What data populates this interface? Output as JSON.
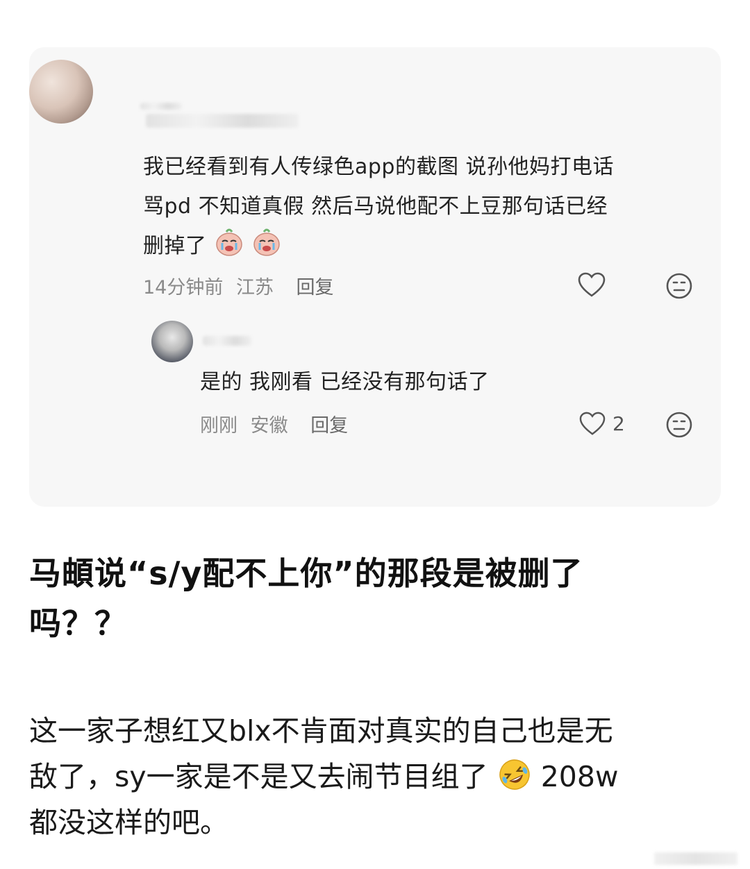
{
  "comment": {
    "text_line1": "我已经看到有人传绿色app的截图 说孙他妈打电话",
    "text_line2": "骂pd  不知道真假 然后马说他配不上豆那句话已经",
    "text_line3": "删掉了",
    "time": "14分钟前",
    "location": "江苏",
    "reply_label": "回复"
  },
  "reply": {
    "text": "是的  我刚看  已经没有那句话了",
    "time": "刚刚",
    "location": "安徽",
    "reply_label": "回复",
    "like_count": "2"
  },
  "post": {
    "headline_line1": "马頔说“s/y配不上你”的那段是被删了",
    "headline_line2": "吗？？",
    "body_line1": "这一家子想红又blx不肯面对真实的自己也是无",
    "body_line2a": "敌了，sy一家是不是又去闹节目组了",
    "body_line2b": "208w",
    "body_line3": "都没这样的吧。"
  },
  "icons": {
    "heart": "heart-outline-icon",
    "expression": "neutral-face-icon",
    "crying_emoji": "crying-emoji-icon",
    "rofl_emoji": "rolling-laughing-emoji-icon"
  }
}
